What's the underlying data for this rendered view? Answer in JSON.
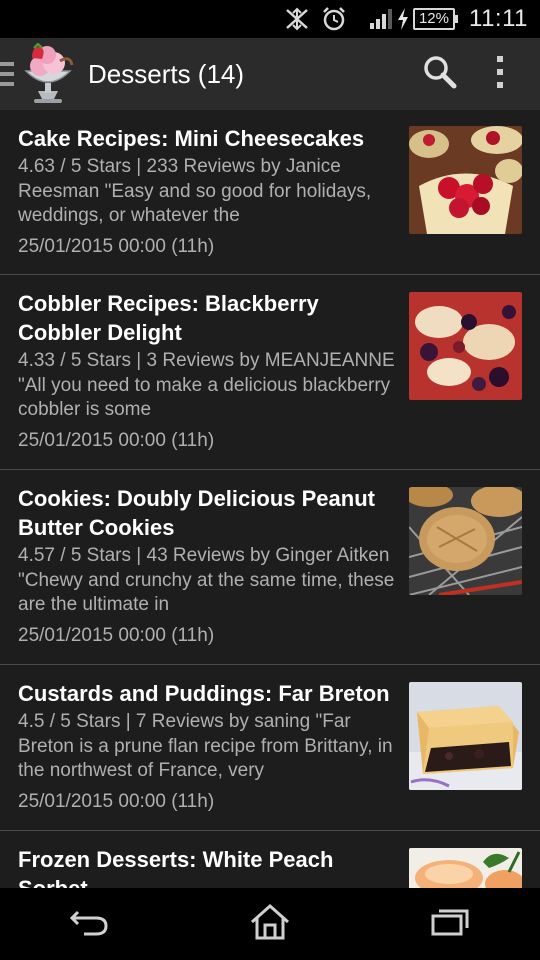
{
  "status_bar": {
    "battery": "12%",
    "time": "11:11",
    "icons": [
      "nfc-icon",
      "alarm-icon",
      "signal-icon",
      "charging-icon"
    ]
  },
  "action_bar": {
    "title": "Desserts (14)",
    "icons": [
      "drawer-indicator-icon",
      "ice-cream-sundae-logo",
      "search-icon",
      "overflow-menu-icon"
    ]
  },
  "items": [
    {
      "title": "Cake Recipes: Mini Cheesecakes",
      "description": "4.63 / 5 Stars | 233 Reviews    by Janice Reesman    \"Easy and so good for holidays, weddings, or whatever the",
      "date": "25/01/2015 00:00 (11h)",
      "image": "mini-cheesecakes-thumbnail"
    },
    {
      "title": "Cobbler Recipes: Blackberry Cobbler Delight",
      "description": "4.33 / 5 Stars | 3 Reviews    by MEANJEANNE    \"All you need to make a delicious blackberry cobbler is some",
      "date": "25/01/2015 00:00 (11h)",
      "image": "blackberry-cobbler-thumbnail"
    },
    {
      "title": "Cookies: Doubly Delicious Peanut Butter Cookies",
      "description": "4.57 / 5 Stars | 43 Reviews    by Ginger Aitken    \"Chewy and crunchy at the same time, these are the ultimate in",
      "date": "25/01/2015 00:00 (11h)",
      "image": "peanut-butter-cookies-thumbnail"
    },
    {
      "title": "Custards and Puddings: Far Breton",
      "description": "4.5 / 5 Stars | 7 Reviews    by saning \"Far Breton is a prune flan recipe from Brittany, in the northwest of France, very",
      "date": "25/01/2015 00:00 (11h)",
      "image": "far-breton-thumbnail"
    },
    {
      "title": "Frozen Desserts: White Peach Sorbet",
      "description": "",
      "date": "",
      "image": "white-peach-sorbet-thumbnail"
    }
  ],
  "nav_bar": {
    "icons": [
      "back-icon",
      "home-icon",
      "recent-apps-icon"
    ]
  }
}
